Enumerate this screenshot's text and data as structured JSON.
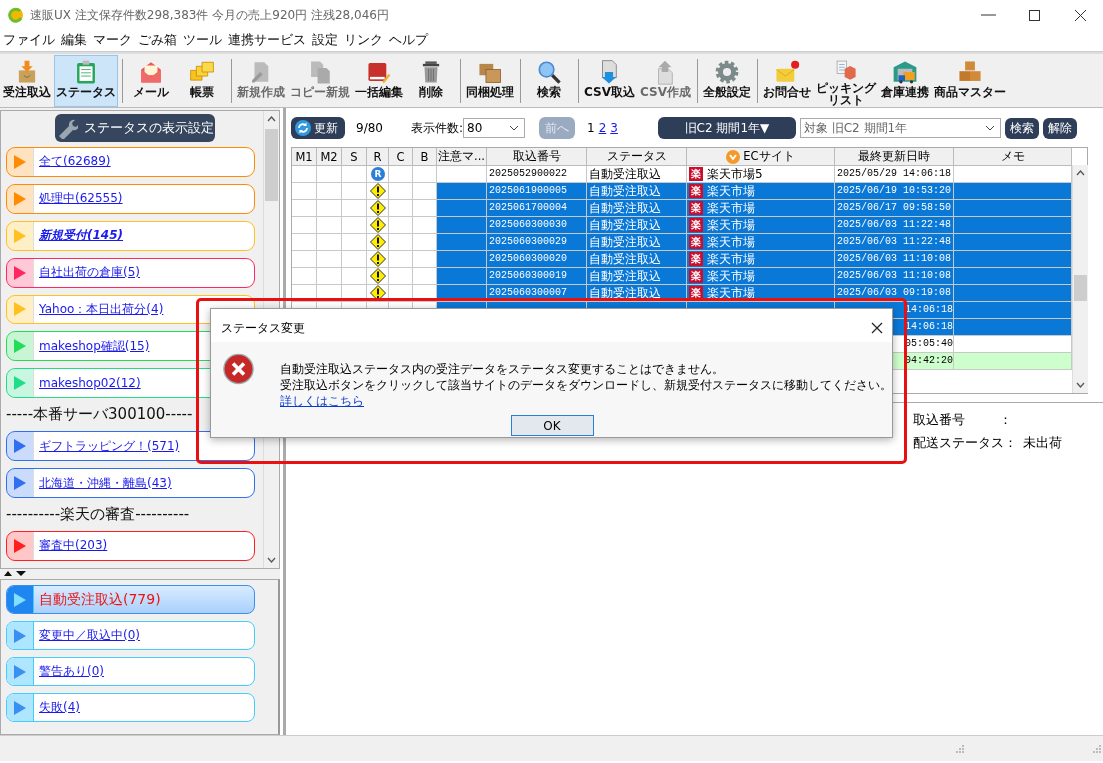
{
  "window": {
    "title": "速販UX 注文保存件数298,383件 今月の売上920円 注残28,046円"
  },
  "menu": [
    "ファイル",
    "編集",
    "マーク",
    "ごみ箱",
    "ツール",
    "連携サービス",
    "設定",
    "リンク",
    "ヘルプ"
  ],
  "toolbar": [
    {
      "kind": "button",
      "label": "受注取込",
      "selected": false,
      "disabled": false
    },
    {
      "kind": "button",
      "label": "ステータス",
      "selected": true,
      "disabled": false
    },
    {
      "kind": "separator"
    },
    {
      "kind": "button",
      "label": "メール",
      "selected": false,
      "disabled": false
    },
    {
      "kind": "button",
      "label": "帳票",
      "selected": false,
      "disabled": false
    },
    {
      "kind": "separator"
    },
    {
      "kind": "button",
      "label": "新規作成",
      "selected": false,
      "disabled": true
    },
    {
      "kind": "button",
      "label": "コピー新規",
      "selected": false,
      "disabled": true
    },
    {
      "kind": "button",
      "label": "一括編集",
      "selected": false,
      "disabled": false
    },
    {
      "kind": "button",
      "label": "削除",
      "selected": false,
      "disabled": false
    },
    {
      "kind": "separator"
    },
    {
      "kind": "button",
      "label": "同梱処理",
      "selected": false,
      "disabled": false
    },
    {
      "kind": "separator"
    },
    {
      "kind": "button",
      "label": "検索",
      "selected": false,
      "disabled": false
    },
    {
      "kind": "separator"
    },
    {
      "kind": "button",
      "label": "CSV取込",
      "selected": false,
      "disabled": false
    },
    {
      "kind": "button",
      "label": "CSV作成",
      "selected": false,
      "disabled": true
    },
    {
      "kind": "separator"
    },
    {
      "kind": "button",
      "label": "全般設定",
      "selected": false,
      "disabled": false
    },
    {
      "kind": "separator"
    },
    {
      "kind": "button",
      "label": "お問合せ",
      "selected": false,
      "disabled": false
    },
    {
      "kind": "button",
      "lines": [
        "ピッキング",
        "リスト"
      ],
      "selected": false,
      "disabled": false
    },
    {
      "kind": "button",
      "label": "倉庫連携",
      "selected": false,
      "disabled": false
    },
    {
      "kind": "button",
      "label": "商品マスター",
      "selected": false,
      "disabled": false
    }
  ],
  "status_panel": {
    "settings_button": "ステータスの表示設定",
    "items": [
      {
        "kind": "status",
        "label": "全て(62689)",
        "color": "#ff8c00",
        "emphasis": false,
        "selected": false
      },
      {
        "kind": "status",
        "label": "処理中(62555)",
        "color": "#ff8c00",
        "emphasis": false,
        "selected": false
      },
      {
        "kind": "status",
        "label": "新規受付(145)",
        "color": "#ffc020",
        "emphasis": true,
        "selected": false
      },
      {
        "kind": "status",
        "label": "自社出荷の倉庫(5)",
        "color": "#ff2860",
        "emphasis": false,
        "selected": false
      },
      {
        "kind": "status",
        "label": "Yahoo：本日出荷分(4)",
        "color": "#ffc020",
        "emphasis": false,
        "selected": false
      },
      {
        "kind": "status",
        "label": "makeshop確認(15)",
        "color": "#22dd55",
        "emphasis": false,
        "selected": false
      },
      {
        "kind": "status",
        "label": "makeshop02(12)",
        "color": "#22dd88",
        "emphasis": false,
        "selected": false
      },
      {
        "kind": "heading",
        "label": "-----本番サーバ300100-----"
      },
      {
        "kind": "status",
        "label": "ギフトラッピング！(571)",
        "color": "#2f6ff0",
        "emphasis": false,
        "selected": false
      },
      {
        "kind": "status",
        "label": "北海道・沖縄・離島(43)",
        "color": "#2f6ff0",
        "emphasis": false,
        "selected": false
      },
      {
        "kind": "heading",
        "label": "----------楽天の審査----------"
      },
      {
        "kind": "status",
        "label": "審査中(203)",
        "color": "#ff2020",
        "emphasis": false,
        "selected": false
      }
    ]
  },
  "queue_panel": {
    "items": [
      {
        "label": "自動受注取込(779)",
        "selected": true
      },
      {
        "label": "変更中／取込中(0)",
        "selected": false
      },
      {
        "label": "警告あり(0)",
        "selected": false
      },
      {
        "label": "失敗(4)",
        "selected": false
      }
    ]
  },
  "list_toolbar": {
    "refresh_button": "更新",
    "count": "9/80",
    "page_size_label": "表示件数:",
    "page_size": "80",
    "prev_button": {
      "label": "前へ",
      "disabled": true
    },
    "pages": [
      {
        "label": "1",
        "selected": true
      },
      {
        "label": "2",
        "selected": false
      },
      {
        "label": "3",
        "selected": false
      }
    ],
    "period_button": "旧C2 期間1年▼",
    "filter": "対象 旧C2 期間1年",
    "search_button": "検索",
    "clear_button": "解除"
  },
  "table": {
    "columns": [
      {
        "label": "M1",
        "sorted": false
      },
      {
        "label": "M2",
        "sorted": false
      },
      {
        "label": "S",
        "sorted": false
      },
      {
        "label": "R",
        "sorted": false
      },
      {
        "label": "C",
        "sorted": false
      },
      {
        "label": "B",
        "sorted": false
      },
      {
        "label": "注意マ...",
        "sorted": false
      },
      {
        "label": "取込番号",
        "sorted": false
      },
      {
        "label": "ステータス",
        "sorted": false
      },
      {
        "label": "ECサイト",
        "sorted": true
      },
      {
        "label": "最終更新日時",
        "sorted": false
      },
      {
        "label": "メモ",
        "sorted": false
      }
    ],
    "rows": [
      {
        "kind": "full",
        "selected": false,
        "r_mark": {
          "kind": "badge",
          "label": "R"
        },
        "order_no": "2025052900022",
        "status": "自動受注取込",
        "site_badge": "楽",
        "site": "楽天市場5",
        "updated": "2025/05/29 14:06:18"
      },
      {
        "kind": "full",
        "selected": true,
        "r_mark": {
          "kind": "warning"
        },
        "order_no": "2025061900005",
        "status": "自動受注取込",
        "site_badge": "楽",
        "site": "楽天市場",
        "updated": "2025/06/19 10:53:20"
      },
      {
        "kind": "full",
        "selected": true,
        "r_mark": {
          "kind": "warning"
        },
        "order_no": "2025061700004",
        "status": "自動受注取込",
        "site_badge": "楽",
        "site": "楽天市場",
        "updated": "2025/06/17 09:58:50"
      },
      {
        "kind": "full",
        "selected": true,
        "r_mark": {
          "kind": "warning"
        },
        "order_no": "2025060300030",
        "status": "自動受注取込",
        "site_badge": "楽",
        "site": "楽天市場",
        "updated": "2025/06/03 11:22:48"
      },
      {
        "kind": "full",
        "selected": true,
        "r_mark": {
          "kind": "warning"
        },
        "order_no": "2025060300029",
        "status": "自動受注取込",
        "site_badge": "楽",
        "site": "楽天市場",
        "updated": "2025/06/03 11:22:48"
      },
      {
        "kind": "full",
        "selected": true,
        "r_mark": {
          "kind": "warning"
        },
        "order_no": "2025060300020",
        "status": "自動受注取込",
        "site_badge": "楽",
        "site": "楽天市場",
        "updated": "2025/06/03 11:10:08"
      },
      {
        "kind": "full",
        "selected": true,
        "r_mark": {
          "kind": "warning"
        },
        "order_no": "2025060300019",
        "status": "自動受注取込",
        "site_badge": "楽",
        "site": "楽天市場",
        "updated": "2025/06/03 11:10:08"
      },
      {
        "kind": "full",
        "selected": true,
        "r_mark": {
          "kind": "warning"
        },
        "order_no": "2025060300007",
        "status": "自動受注取込",
        "site_badge": "楽",
        "site": "楽天市場",
        "updated": "2025/06/03 09:19:08"
      },
      {
        "kind": "partial",
        "selected": true,
        "updated": "14:06:18"
      },
      {
        "kind": "partial",
        "selected": true,
        "updated": "14:06:18"
      },
      {
        "kind": "partial",
        "selected": false,
        "updated": "05:05:40"
      },
      {
        "kind": "partial",
        "selected": false,
        "color": "#ccffcc",
        "updated": "04:42:20"
      }
    ]
  },
  "detail": {
    "fields": [
      {
        "label": "取込番号",
        "colon": "："
      },
      {
        "label": "配送ステータス",
        "colon": "：",
        "value": "未出荷"
      }
    ]
  },
  "dialog": {
    "title": "ステータス変更",
    "lines": [
      "自動受注取込ステータス内の受注データをステータス変更することはできません。",
      "受注取込ボタンをクリックして該当サイトのデータをダウンロードし、新規受付ステータスに移動してください。"
    ],
    "link": "詳しくはこちら",
    "ok_button": "OK"
  }
}
